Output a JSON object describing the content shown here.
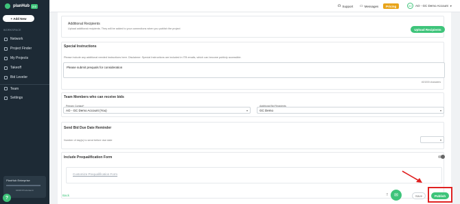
{
  "brand": {
    "name": "planHub",
    "tag": "2.0"
  },
  "sidebar": {
    "add_new": "+ Add New",
    "section_label": "WORKSPACE",
    "items": [
      {
        "label": "Network"
      },
      {
        "label": "Project Finder"
      },
      {
        "label": "My Projects"
      },
      {
        "label": "Takeoff"
      },
      {
        "label": "Bid Leveler"
      },
      {
        "label": "Team"
      },
      {
        "label": "Settings"
      }
    ],
    "enterprise_title": "PlanHub Enterprise",
    "enterprise_sub": "10/40 Of License In"
  },
  "topbar": {
    "support": "Support",
    "messages": "Messages",
    "pricing": "Pricing",
    "avatar": "AO",
    "account": "AO - GC Demo Account"
  },
  "recipients": {
    "title": "Additional Recipients",
    "desc": "Upload additional recipients. They will be added to your connections when you publish the project",
    "button": "Upload Recipients"
  },
  "instructions": {
    "title": "Special Instructions",
    "desc": "Please include any additional needed instructions here. Disclaimer: Special Instructions are included in ITB emails, which can become publicly accessible.",
    "value": "Please submit prequals for consideration",
    "counter": "40/1000 characters"
  },
  "team": {
    "title": "Team Members who can receive bids",
    "primary_label": "Primary Contact*",
    "primary_value": "AO - GC Demo Account (You)",
    "additional_label": "Additional Bid Recipients",
    "additional_value": "GC Demo"
  },
  "reminder": {
    "title": "Send Bid Due Date Reminder",
    "label": "Number of day(s) to send before due date"
  },
  "prequal": {
    "title": "Include Prequalification Form",
    "link": "Customize Prequalification Form"
  },
  "footer": {
    "back": "Back",
    "save": "Save",
    "publish": "Publish"
  },
  "colors": {
    "accent": "#3ec47a",
    "sidebar": "#1d2a35",
    "highlight": "#e02020",
    "pricing": "#e8a41a"
  }
}
